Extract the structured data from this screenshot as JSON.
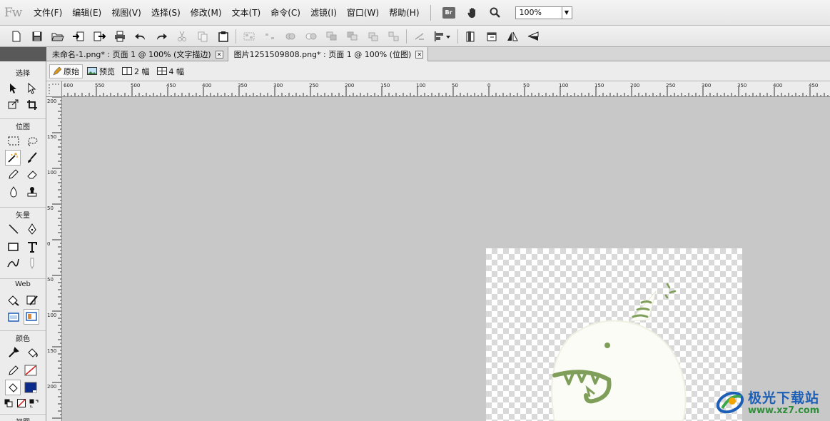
{
  "app": {
    "logo": "Fw"
  },
  "menu": [
    "文件(F)",
    "编辑(E)",
    "视图(V)",
    "选择(S)",
    "修改(M)",
    "文本(T)",
    "命令(C)",
    "滤镜(I)",
    "窗口(W)",
    "帮助(H)"
  ],
  "menubar_tools": {
    "bridge_label": "Br",
    "zoom_value": "100%"
  },
  "toolbar_icons": [
    "new-icon",
    "save-icon",
    "open-icon",
    "import-icon",
    "export-icon",
    "print-icon",
    "undo-icon",
    "redo-icon",
    "cut-icon",
    "copy-icon",
    "paste-icon",
    "group-icon",
    "ungroup-icon",
    "join-icon",
    "split-icon",
    "bring-front-icon",
    "bring-forward-icon",
    "send-backward-icon",
    "send-back-icon",
    "rotate-icon",
    "align-icon",
    "export-wizard-icon",
    "preview-icon",
    "flip-horizontal-icon",
    "flip-vertical-icon"
  ],
  "tabs": [
    {
      "label": "未命名-1.png* : 页面 1 @ 100% (文字描边)",
      "active": false
    },
    {
      "label": "图片1251509808.png* : 页面 1 @ 100% (位图)",
      "active": true
    }
  ],
  "view_modes": [
    "原始",
    "预览",
    "2 幅",
    "4 幅"
  ],
  "tools_sections": {
    "select": "选择",
    "bitmap": "位图",
    "vector": "矢量",
    "web": "Web",
    "colors": "颜色",
    "view": "视图"
  },
  "colors": {
    "stroke": "#000000",
    "fill": "#0a2a8c",
    "accent_green": "#7f9e5a"
  },
  "ruler_h_labels": [
    "600",
    "550",
    "500",
    "450",
    "400",
    "350",
    "300",
    "250",
    "200",
    "150",
    "100",
    "50",
    "0",
    "50",
    "100",
    "150",
    "200",
    "250",
    "300",
    "350",
    "400",
    "450"
  ],
  "ruler_v_labels": [
    "200",
    "150",
    "100",
    "50",
    "0",
    "50",
    "100",
    "150",
    "200"
  ],
  "watermark": {
    "title": "极光下载站",
    "url": "www.xz7.com"
  }
}
